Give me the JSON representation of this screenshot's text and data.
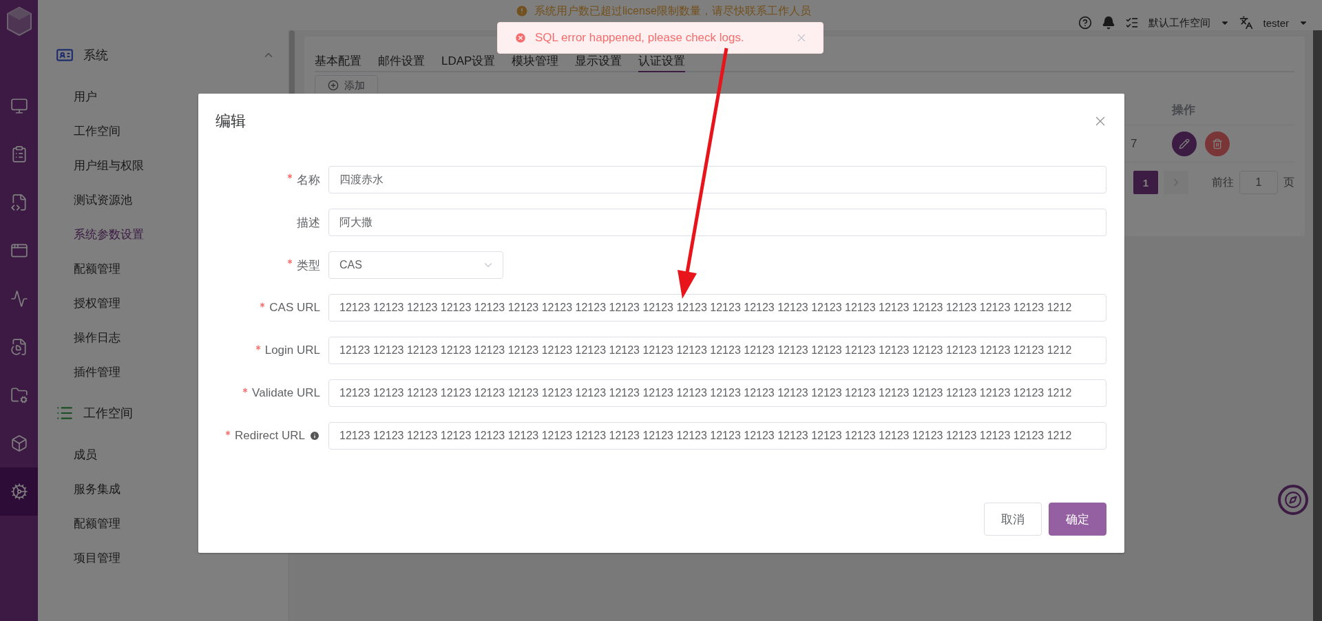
{
  "rail": {
    "items": [
      {
        "kind": "monitor",
        "selected": false
      },
      {
        "kind": "clipboard",
        "selected": false
      },
      {
        "kind": "api",
        "selected": false
      },
      {
        "kind": "ui",
        "selected": false
      },
      {
        "kind": "performance",
        "selected": false
      },
      {
        "kind": "report",
        "selected": false
      },
      {
        "kind": "folder",
        "selected": false
      },
      {
        "kind": "cube",
        "selected": false
      },
      {
        "kind": "settings",
        "selected": true
      }
    ]
  },
  "header": {
    "warning": "系统用户数已超过license限制数量，请尽快联系工作人员",
    "workspace": "默认工作空间",
    "user": "tester"
  },
  "sidebar": {
    "sections": [
      {
        "title": "系统",
        "kind": "system",
        "expanded": true,
        "items": [
          {
            "label": "用户",
            "selected": false
          },
          {
            "label": "工作空间",
            "selected": false
          },
          {
            "label": "用户组与权限",
            "selected": false
          },
          {
            "label": "测试资源池",
            "selected": false
          },
          {
            "label": "系统参数设置",
            "selected": true
          },
          {
            "label": "配额管理",
            "selected": false
          },
          {
            "label": "授权管理",
            "selected": false
          },
          {
            "label": "操作日志",
            "selected": false
          },
          {
            "label": "插件管理",
            "selected": false
          }
        ]
      },
      {
        "title": "工作空间",
        "kind": "workspace",
        "items": [
          {
            "label": "成员",
            "selected": false
          },
          {
            "label": "服务集成",
            "selected": false
          },
          {
            "label": "配额管理",
            "selected": false
          },
          {
            "label": "项目管理",
            "selected": false
          }
        ]
      }
    ]
  },
  "tabs": [
    {
      "label": "基本配置",
      "selected": false
    },
    {
      "label": "邮件设置",
      "selected": false
    },
    {
      "label": "LDAP设置",
      "selected": false
    },
    {
      "label": "模块管理",
      "selected": false
    },
    {
      "label": "显示设置",
      "selected": false
    },
    {
      "label": "认证设置",
      "selected": true
    }
  ],
  "add_button": "添加",
  "table": {
    "action_header": "操作",
    "rows": [
      {
        "column_1": "7"
      }
    ]
  },
  "pagination": {
    "pages": [
      {
        "label": "1",
        "selected": true
      }
    ],
    "goto_label": "前往",
    "goto_value": "1",
    "page_suffix": "页"
  },
  "toast": {
    "message": "SQL error happened, please check logs."
  },
  "dialog": {
    "title": "编辑",
    "fields": [
      {
        "label": "名称",
        "required": true,
        "info": false,
        "kind": "input",
        "value": "四渡赤水"
      },
      {
        "label": "描述",
        "required": false,
        "info": false,
        "kind": "input",
        "value": "阿大撒"
      },
      {
        "label": "类型",
        "required": true,
        "info": false,
        "kind": "select",
        "value": "CAS"
      },
      {
        "label": "CAS URL",
        "required": true,
        "info": false,
        "kind": "input",
        "value": "12123 12123 12123 12123 12123 12123 12123 12123 12123 12123 12123 12123 12123 12123 12123 12123 12123 12123 12123 12123 12123 1212"
      },
      {
        "label": "Login URL",
        "required": true,
        "info": false,
        "kind": "input",
        "value": "12123 12123 12123 12123 12123 12123 12123 12123 12123 12123 12123 12123 12123 12123 12123 12123 12123 12123 12123 12123 12123 1212"
      },
      {
        "label": "Validate URL",
        "required": true,
        "info": false,
        "kind": "input",
        "value": "12123 12123 12123 12123 12123 12123 12123 12123 12123 12123 12123 12123 12123 12123 12123 12123 12123 12123 12123 12123 12123 1212"
      },
      {
        "label": "Redirect URL",
        "required": true,
        "info": true,
        "kind": "input",
        "value": "12123 12123 12123 12123 12123 12123 12123 12123 12123 12123 12123 12123 12123 12123 12123 12123 12123 12123 12123 12123 12123 1212"
      }
    ],
    "buttons": [
      {
        "label": "取消",
        "kind": "secondary"
      },
      {
        "label": "确定",
        "kind": "primary"
      }
    ]
  }
}
